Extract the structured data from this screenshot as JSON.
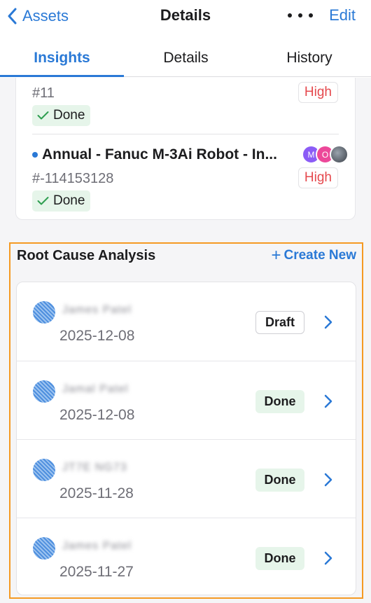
{
  "nav": {
    "back_label": "Assets",
    "title": "Details",
    "edit_label": "Edit",
    "more_icon": "ellipsis-icon"
  },
  "tabs": [
    {
      "label": "Insights",
      "active": true
    },
    {
      "label": "Details",
      "active": false
    },
    {
      "label": "History",
      "active": false
    }
  ],
  "work_orders": [
    {
      "number": "#11",
      "priority": "High",
      "status": "Done"
    },
    {
      "title": "Annual - Fanuc M-3Ai Robot - In...",
      "number": "#-114153128",
      "priority": "High",
      "status": "Done",
      "assignees": [
        "M",
        "O",
        ""
      ]
    }
  ],
  "rca": {
    "title": "Root Cause Analysis",
    "create_label": "Create New",
    "items": [
      {
        "name": "James Patel",
        "date": "2025-12-08",
        "status": "Draft"
      },
      {
        "name": "Jamal Patel",
        "date": "2025-12-08",
        "status": "Done"
      },
      {
        "name": "JT7E NG73",
        "date": "2025-11-28",
        "status": "Done"
      },
      {
        "name": "James Patel",
        "date": "2025-11-27",
        "status": "Done"
      }
    ]
  },
  "colors": {
    "accent": "#2a79d6",
    "priority_high": "#e5484d",
    "done_bg": "#e6f5ea",
    "highlight_border": "#f59a23"
  }
}
